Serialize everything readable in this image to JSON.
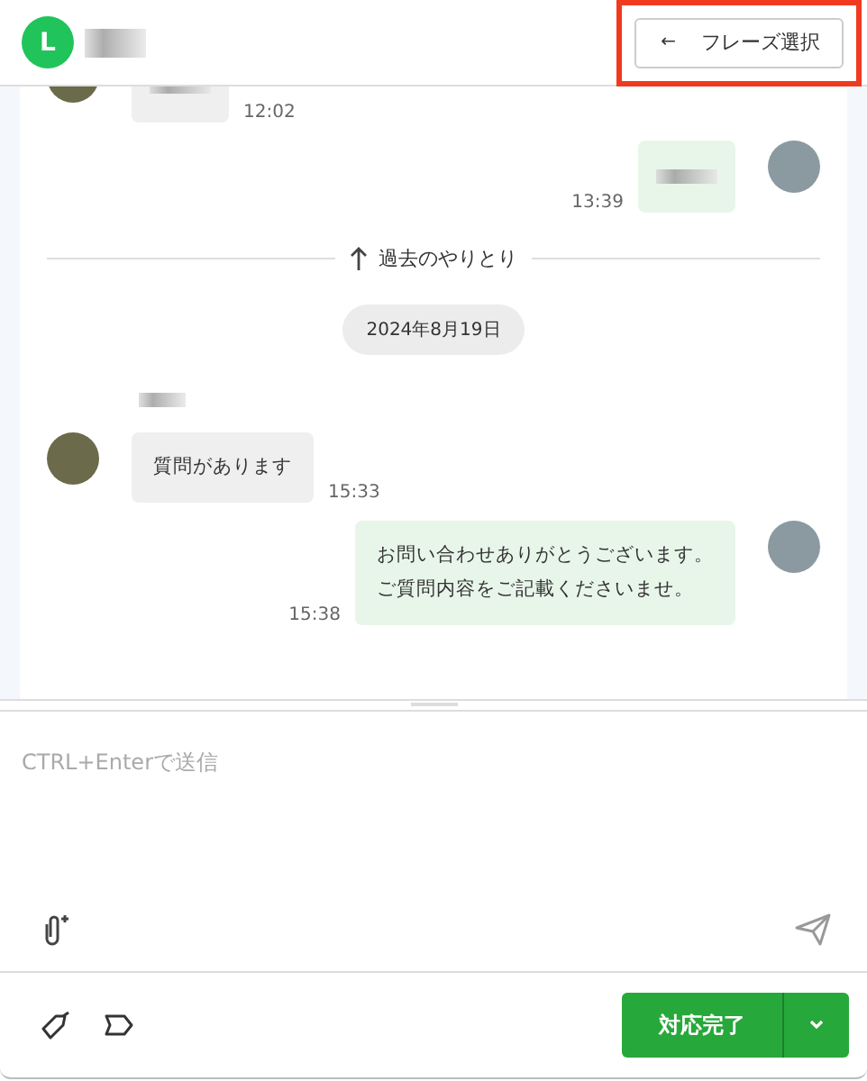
{
  "header": {
    "channel_letter": "L",
    "contact_name_blurred": true,
    "phrase_button": {
      "icon": "←",
      "label": "フレーズ選択",
      "highlighted": true
    }
  },
  "messages": [
    {
      "kind": "incoming",
      "blurred": true,
      "time": "12:02",
      "clipped_top": true
    },
    {
      "kind": "outgoing",
      "blurred": true,
      "time": "13:39"
    },
    {
      "kind": "history_divider",
      "label": "過去のやりとり"
    },
    {
      "kind": "date",
      "label": "2024年8月19日"
    },
    {
      "kind": "incoming",
      "sender_name_blurred": true,
      "lines": [
        "質問があります"
      ],
      "time": "15:33"
    },
    {
      "kind": "outgoing",
      "lines": [
        "お問い合わせありがとうございます。",
        "ご質問内容をご記載くださいませ。"
      ],
      "time": "15:38"
    }
  ],
  "composer": {
    "placeholder": "CTRL+Enterで送信"
  },
  "footer": {
    "complete_button": "対応完了"
  }
}
